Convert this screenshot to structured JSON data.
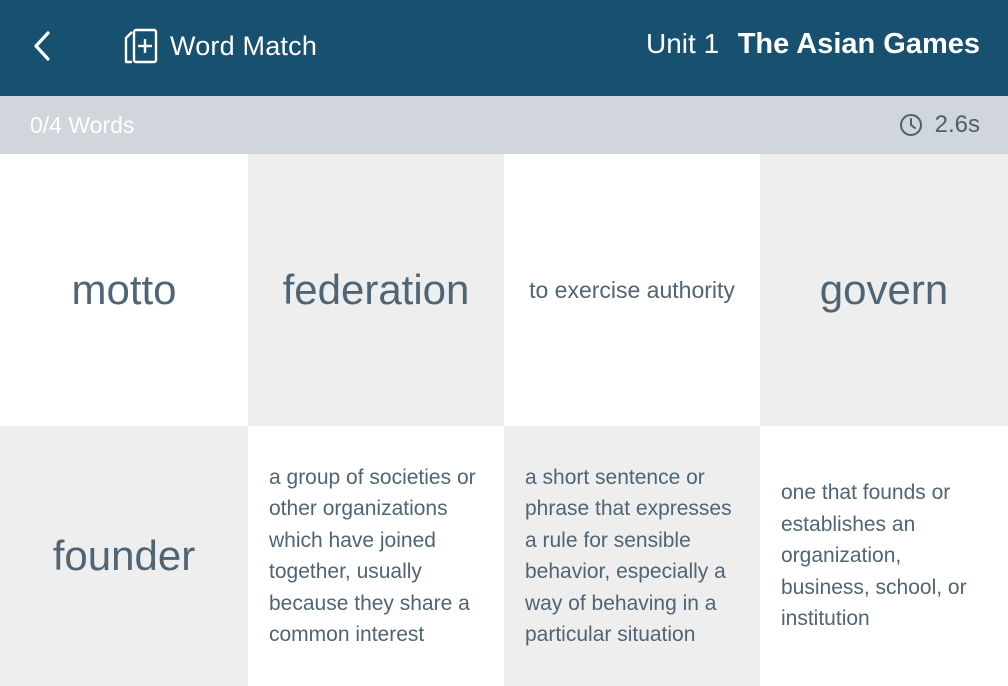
{
  "header": {
    "back_icon": "chevron-left-icon",
    "brand_icon": "add-card-icon",
    "app_title": "Word Match",
    "unit": "Unit 1",
    "lesson": "The Asian Games",
    "background_color": "#18506f"
  },
  "status": {
    "progress": "0/4 Words",
    "timer_icon": "clock-icon",
    "timer": "2.6s"
  },
  "tiles": [
    {
      "text": "motto",
      "kind": "word",
      "shade": "white"
    },
    {
      "text": "federation",
      "kind": "word",
      "shade": "gray"
    },
    {
      "text": "to exercise authority",
      "kind": "definition",
      "shade": "white"
    },
    {
      "text": "govern",
      "kind": "word",
      "shade": "gray"
    },
    {
      "text": "founder",
      "kind": "word",
      "shade": "gray"
    },
    {
      "text": "a group of societies or other organizations which have joined together, usually because they share a common interest",
      "kind": "definition",
      "shade": "white"
    },
    {
      "text": "a short sentence or phrase that expresses a rule for sensible behavior, especially a way of behaving in a particular situation",
      "kind": "definition",
      "shade": "gray"
    },
    {
      "text": "one that founds or establishes an organization, business, school, or institution",
      "kind": "definition",
      "shade": "white"
    }
  ]
}
